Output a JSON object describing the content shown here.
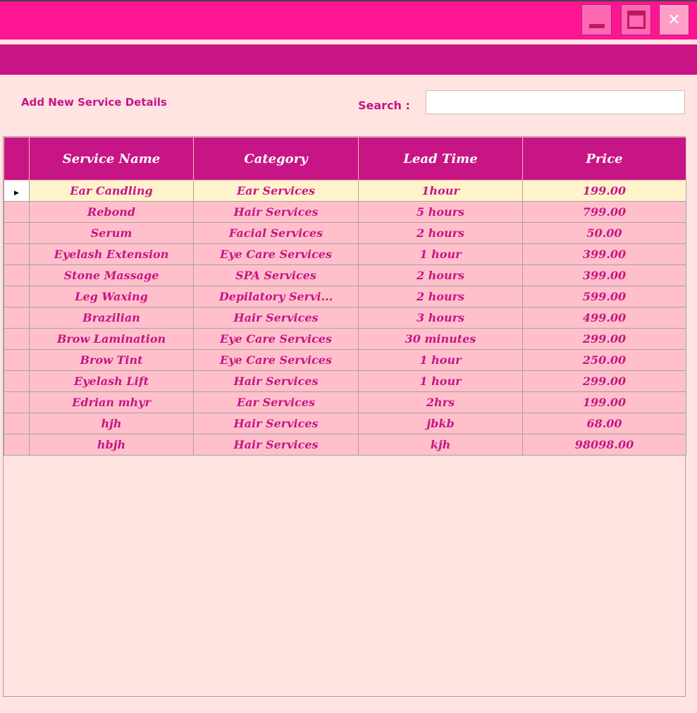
{
  "window": {
    "controls": {
      "minimize": "minimize-icon",
      "maximize": "maximize-icon",
      "close": "close-icon",
      "close_glyph": "✕"
    },
    "colors": {
      "titlebar": "#ff1493",
      "subbar": "#c71585",
      "background": "#ffe4e1",
      "row": "#ffc0cb",
      "selected_row": "#fff3cc"
    }
  },
  "toolbar": {
    "add_link": "Add New Service Details",
    "search_label": "Search :",
    "search_value": ""
  },
  "table": {
    "columns": [
      "Service Name",
      "Category",
      "Lead Time",
      "Price"
    ],
    "selected_row_marker": "▶",
    "rows": [
      [
        "Ear Candling",
        "Ear Services",
        "1hour",
        "199.00"
      ],
      [
        "Rebond",
        "Hair Services",
        "5 hours",
        "799.00"
      ],
      [
        "Serum",
        "Facial Services",
        "2 hours",
        "50.00"
      ],
      [
        "Eyelash Extension",
        "Eye Care Services",
        "1 hour",
        "399.00"
      ],
      [
        "Stone Massage",
        "SPA Services",
        "2 hours",
        "399.00"
      ],
      [
        "Leg Waxing",
        "Depilatory Servi...",
        "2 hours",
        "599.00"
      ],
      [
        "Brazilian",
        "Hair Services",
        "3 hours",
        "499.00"
      ],
      [
        "Brow Lamination",
        "Eye Care Services",
        "30 minutes",
        "299.00"
      ],
      [
        "Brow Tint",
        "Eye Care Services",
        "1 hour",
        "250.00"
      ],
      [
        "Eyelash Lift",
        "Hair Services",
        "1 hour",
        "299.00"
      ],
      [
        "Edrian mhyr",
        "Ear Services",
        "2hrs",
        "199.00"
      ],
      [
        "hjh",
        "Hair Services",
        "jbkb",
        "68.00"
      ],
      [
        "hbjh",
        "Hair Services",
        "kjh",
        "98098.00"
      ]
    ]
  }
}
